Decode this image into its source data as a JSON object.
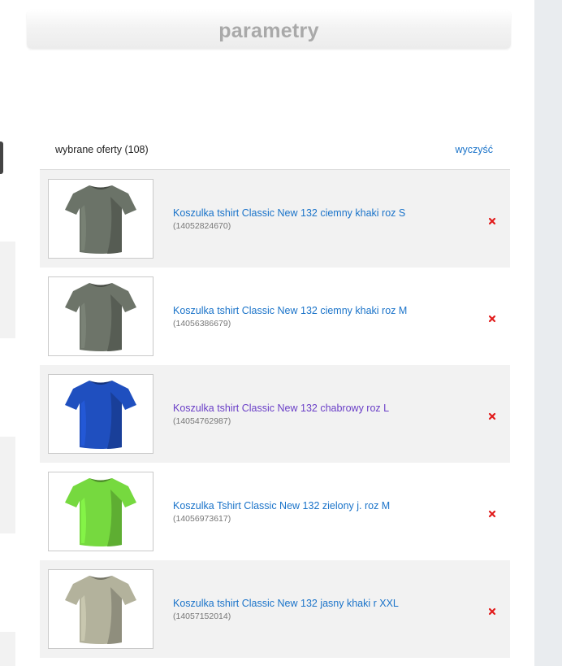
{
  "header": {
    "title": "parametry"
  },
  "selected": {
    "label": "wybrane oferty (108)",
    "clear_label": "wyczyść"
  },
  "offers": [
    {
      "title": "Koszulka tshirt Classic New 132 ciemny khaki roz S",
      "id": "(14052824670)",
      "shirt_color": "#6b7368",
      "visited": false,
      "remove_icon": "close-icon"
    },
    {
      "title": "Koszulka tshirt Classic New 132 ciemny khaki roz M",
      "id": "(14056386679)",
      "shirt_color": "#6d7469",
      "visited": false,
      "remove_icon": "close-icon"
    },
    {
      "title": "Koszulka tshirt Classic New 132 chabrowy roz L",
      "id": "(14054762987)",
      "shirt_color": "#1f4fbf",
      "visited": true,
      "remove_icon": "close-icon"
    },
    {
      "title": "Koszulka Tshirt Classic New 132 zielony j. roz M",
      "id": "(14056973617)",
      "shirt_color": "#76d93f",
      "visited": false,
      "remove_icon": "close-icon"
    },
    {
      "title": "Koszulka tshirt Classic New 132 jasny khaki r XXL",
      "id": "(14057152014)",
      "shirt_color": "#b3b29c",
      "visited": false,
      "remove_icon": "close-icon"
    }
  ],
  "colors": {
    "link": "#1a73c9",
    "visited_link": "#6a3fc7",
    "remove": "#e11b1b",
    "row_alt": "#f2f2f2"
  }
}
